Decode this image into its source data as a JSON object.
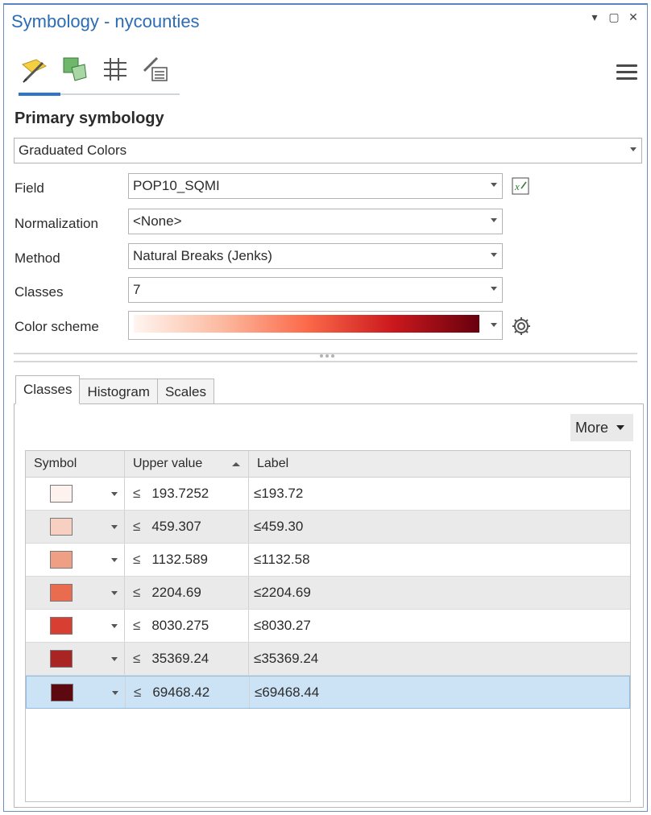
{
  "window": {
    "title": "Symbology - nycounties",
    "pin_glyph": "▾",
    "restore_glyph": "▢",
    "close_glyph": "✕"
  },
  "toolbar": {
    "icons": [
      "primary-symbology-icon",
      "vary-symbology-icon",
      "symbol-layers-icon",
      "symbol-properties-icon"
    ],
    "active_index": 0
  },
  "primary": {
    "heading": "Primary symbology",
    "renderer": "Graduated Colors"
  },
  "fields": {
    "field_label": "Field",
    "field_value": "POP10_SQMI",
    "normalization_label": "Normalization",
    "normalization_value": "<None>",
    "method_label": "Method",
    "method_value": "Natural Breaks (Jenks)",
    "classes_label": "Classes",
    "classes_value": "7",
    "color_scheme_label": "Color scheme",
    "color_scheme_colors": [
      "#fff5f0",
      "#fcbba1",
      "#fb6a4a",
      "#cb181d",
      "#67000d"
    ]
  },
  "tabs": [
    {
      "label": "Classes",
      "active": true
    },
    {
      "label": "Histogram",
      "active": false
    },
    {
      "label": "Scales",
      "active": false
    }
  ],
  "more_button": "More",
  "grid": {
    "headers": [
      "Symbol",
      "Upper value",
      "Label"
    ],
    "le_symbol": "≤",
    "rows": [
      {
        "color": "#fef2ee",
        "upper": "193.7252",
        "label": "≤193.72"
      },
      {
        "color": "#f7d0c2",
        "upper": "459.307",
        "label": "≤459.30"
      },
      {
        "color": "#ef9f83",
        "upper": "1132.589",
        "label": "≤1132.58"
      },
      {
        "color": "#e96c50",
        "upper": "2204.69",
        "label": "≤2204.69"
      },
      {
        "color": "#d83e31",
        "upper": "8030.275",
        "label": "≤8030.27"
      },
      {
        "color": "#a82523",
        "upper": "35369.24",
        "label": "≤35369.24"
      },
      {
        "color": "#5c0a10",
        "upper": "69468.42",
        "label": "≤69468.44"
      }
    ],
    "selected_index": 6
  }
}
